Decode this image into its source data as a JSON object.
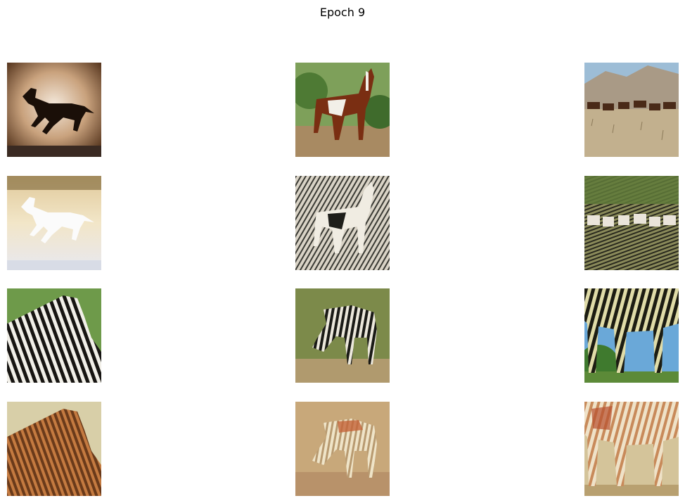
{
  "figure": {
    "title": "Epoch 9",
    "grid": {
      "rows": 4,
      "cols": 3
    },
    "rows": [
      {
        "images": [
          {
            "icon": "horse-silhouette-sepia-image"
          },
          {
            "icon": "pinto-horse-standing-image"
          },
          {
            "icon": "horse-herd-desert-image"
          }
        ]
      },
      {
        "images": [
          {
            "icon": "generated-white-horse-image"
          },
          {
            "icon": "generated-zebra-textured-horse-image"
          },
          {
            "icon": "generated-zebra-herd-image"
          }
        ]
      },
      {
        "images": [
          {
            "icon": "zebra-pair-closeup-image"
          },
          {
            "icon": "zebra-grazing-image"
          },
          {
            "icon": "zebra-legs-closeup-image"
          }
        ]
      },
      {
        "images": [
          {
            "icon": "generated-horse-from-zebra-pair-image"
          },
          {
            "icon": "generated-horse-from-grazing-zebra-image"
          },
          {
            "icon": "generated-horse-from-zebra-legs-image"
          }
        ]
      }
    ],
    "colors": {
      "background": "#ffffff",
      "title": "#000000"
    }
  }
}
